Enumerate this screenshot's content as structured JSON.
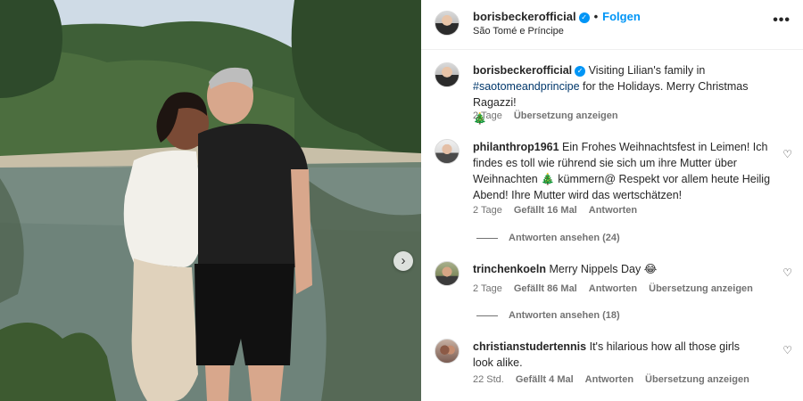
{
  "post": {
    "next_arrow": "›"
  },
  "header": {
    "username": "borisbeckerofficial",
    "verified_mark": "✓",
    "separator": "•",
    "follow_label": "Folgen",
    "location": "São Tomé e Príncipe",
    "more_label": "•••"
  },
  "caption": {
    "username": "borisbeckerofficial",
    "verified_mark": "✓",
    "text_before": "Visiting Lilian's family in",
    "hashtag": "#saotomeandprincipe",
    "text_after": "for the Holidays. Merry Christmas Ragazzi!",
    "emoji": "🎄",
    "time": "2 Tage",
    "translate": "Übersetzung anzeigen"
  },
  "comments": [
    {
      "username": "philanthrop1961",
      "text": "Ein Frohes Weihnachtsfest in Leimen! Ich findes es toll wie rührend sie sich um ihre Mutter über Weihnachten 🎄 kümmern@ Respekt vor allem heute Heilig Abend! Ihre Mutter wird das wertschätzen!",
      "time": "2 Tage",
      "likes": "Gefällt 16 Mal",
      "reply": "Antworten",
      "view_replies": "Antworten ansehen (24)"
    },
    {
      "username": "trinchenkoeln",
      "text": "Merry Nippels Day 😂",
      "time": "2 Tage",
      "likes": "Gefällt 86 Mal",
      "reply": "Antworten",
      "translate": "Übersetzung anzeigen",
      "view_replies": "Antworten ansehen (18)"
    },
    {
      "username": "christianstudertennis",
      "text": "It's hilarious how all those girls look alike.",
      "time": "22 Std.",
      "likes": "Gefällt 4 Mal",
      "reply": "Antworten",
      "translate": "Übersetzung anzeigen"
    }
  ],
  "heart_icon": "♡",
  "colors": {
    "accent_blue": "#0095f6",
    "hashtag_blue": "#00376b",
    "meta_gray": "#737373"
  }
}
